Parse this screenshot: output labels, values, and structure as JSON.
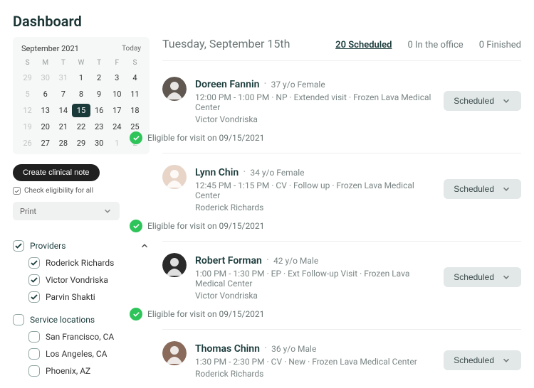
{
  "title": "Dashboard",
  "calendar": {
    "month": "September 2021",
    "today_label": "Today",
    "dow": [
      "S",
      "M",
      "T",
      "W",
      "T",
      "F",
      "S"
    ],
    "weeks": [
      [
        {
          "n": 29,
          "dim": true
        },
        {
          "n": 30,
          "dim": true
        },
        {
          "n": 31,
          "dim": true
        },
        {
          "n": 1
        },
        {
          "n": 2
        },
        {
          "n": 3
        },
        {
          "n": 4
        }
      ],
      [
        {
          "n": 5,
          "dim": true
        },
        {
          "n": 6
        },
        {
          "n": 7
        },
        {
          "n": 8
        },
        {
          "n": 9
        },
        {
          "n": 10
        },
        {
          "n": 11
        }
      ],
      [
        {
          "n": 12,
          "dim": true
        },
        {
          "n": 13
        },
        {
          "n": 14
        },
        {
          "n": 15,
          "sel": true
        },
        {
          "n": 16
        },
        {
          "n": 17
        },
        {
          "n": 18
        }
      ],
      [
        {
          "n": 19,
          "dim": true
        },
        {
          "n": 20
        },
        {
          "n": 21
        },
        {
          "n": 22
        },
        {
          "n": 23
        },
        {
          "n": 24
        },
        {
          "n": 25
        }
      ],
      [
        {
          "n": 26,
          "dim": true
        },
        {
          "n": 27
        },
        {
          "n": 28
        },
        {
          "n": 29
        },
        {
          "n": 30
        },
        {
          "n": 1,
          "dim": true
        },
        {
          "n": 2,
          "dim": true
        }
      ]
    ]
  },
  "actions": {
    "create_note": "Create clinical note",
    "check_all": "Check eligibility for all",
    "print": "Print"
  },
  "filters": {
    "providers": {
      "label": "Providers",
      "checked": true,
      "expanded": true,
      "items": [
        {
          "label": "Roderick Richards",
          "checked": true
        },
        {
          "label": "Victor Vondriska",
          "checked": true
        },
        {
          "label": "Parvin Shakti",
          "checked": true
        }
      ]
    },
    "locations": {
      "label": "Service locations",
      "checked": false,
      "expanded": true,
      "items": [
        {
          "label": "San Francisco, CA",
          "checked": false
        },
        {
          "label": "Los Angeles, CA",
          "checked": false
        },
        {
          "label": "Phoenix, AZ",
          "checked": false
        }
      ]
    }
  },
  "header": {
    "date": "Tuesday, September 15th",
    "tabs": [
      {
        "label": "20 Scheduled",
        "active": true
      },
      {
        "label": "0 In the office",
        "active": false
      },
      {
        "label": "0 Finished",
        "active": false
      }
    ]
  },
  "appointments": [
    {
      "name": "Doreen Fannin",
      "demo": "37 y/o Female",
      "detail": "12:00 PM - 1:00 PM · NP · Extended visit · Frozen Lava Medical Center",
      "provider": "Victor Vondriska",
      "eligible": "Eligible for visit on 09/15/2021",
      "status": "Scheduled",
      "avatar_bg": "#605850"
    },
    {
      "name": "Lynn Chin",
      "demo": "34 y/o Female",
      "detail": "12:45 PM - 1:15 PM · CV · Follow up · Frozen Lava Medical Center",
      "provider": "Roderick Richards",
      "eligible": "Eligible for visit on 09/15/2021",
      "status": "Scheduled",
      "avatar_bg": "#e8d5c8"
    },
    {
      "name": "Robert Forman",
      "demo": "42 y/o Male",
      "detail": "1:00 PM - 1:30 PM · EP · Ext Follow-up Visit · Frozen Lava Medical Center",
      "provider": "Victor Vondriska",
      "eligible": "Eligible for visit on 09/15/2021",
      "status": "Scheduled",
      "avatar_bg": "#2a2a2a"
    },
    {
      "name": "Thomas Chinn",
      "demo": "36 y/o Male",
      "detail": "1:30 PM - 2:30 PM · CV · New · Frozen Lava Medical Center",
      "provider": "Roderick Richards",
      "eligible": "",
      "status": "Scheduled",
      "avatar_bg": "#8a6a5a"
    }
  ]
}
